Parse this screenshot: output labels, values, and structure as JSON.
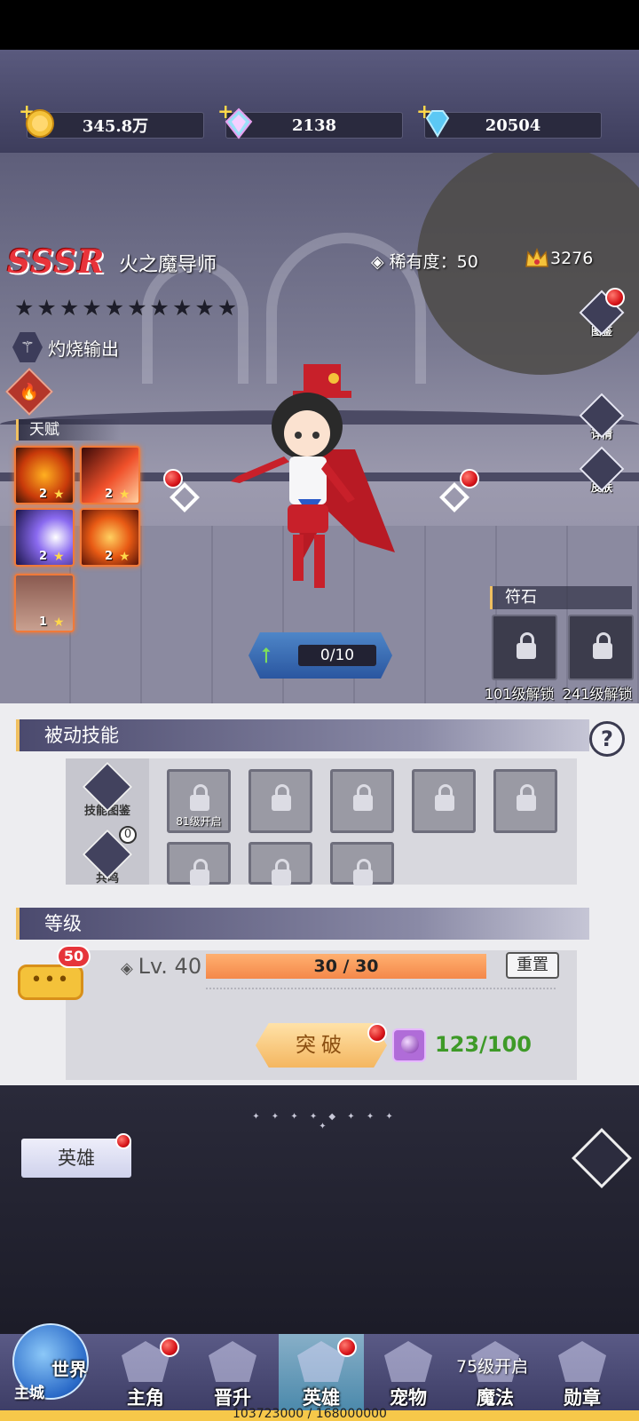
{
  "resources": [
    {
      "icon": "gold-coin-icon",
      "value": "345.8万"
    },
    {
      "icon": "rainbow-crystal-icon",
      "value": "2138"
    },
    {
      "icon": "blue-diamond-icon",
      "value": "20504"
    }
  ],
  "hero": {
    "rarity": "SSSR",
    "name": "火之魔导师",
    "rarity_label": "稀有度：50",
    "power": "3276",
    "role": "灼烧输出",
    "stars_total": 10,
    "stars_filled": 0
  },
  "talents": {
    "header": "天赋",
    "items": [
      {
        "icon": "fireball-icon",
        "level": "2",
        "star": "★"
      },
      {
        "icon": "meteor-icon",
        "level": "2",
        "star": "★"
      },
      {
        "icon": "wind-slash-icon",
        "level": "2",
        "star": "★"
      },
      {
        "icon": "phoenix-icon",
        "level": "2",
        "star": "★"
      },
      {
        "icon": "helmet-icon",
        "level": "1",
        "star": "★"
      }
    ]
  },
  "side_buttons": {
    "codex": "图鉴",
    "details": "详情",
    "skin": "皮肤"
  },
  "runes": {
    "header": "符石",
    "slots": [
      {
        "label": "101级解锁"
      },
      {
        "label": "241级解锁"
      }
    ]
  },
  "upgrade": {
    "progress": "0/10"
  },
  "passive": {
    "header": "被动技能",
    "help": "?",
    "skill_codex": "技能图鉴",
    "resonance": "共鸣",
    "resonance_count": "0",
    "first_slot_label": "81级开启"
  },
  "level": {
    "header": "等级",
    "lv": "Lv. 40",
    "xp": "30 / 30",
    "xp_fraction": 1.0,
    "reset": "重置",
    "chat_badge": "50",
    "chat_dots": "•••",
    "breakthrough": "突破",
    "break_count": "123/100"
  },
  "lower": {
    "hero_tab": "英雄",
    "deco": "✦ ✦ ✦ ✦ ◆ ✦ ✦ ✦ ✦"
  },
  "nav": {
    "world": "世界",
    "main_city": "主城",
    "items": [
      "主角",
      "晋升",
      "英雄",
      "宠物",
      "魔法",
      "勋章"
    ],
    "unlock_note": "75级开启",
    "exp": "103723000 / 168000000"
  },
  "colors": {
    "accent_red": "#e8333a",
    "gold": "#f0c060",
    "green": "#3e9a28"
  }
}
